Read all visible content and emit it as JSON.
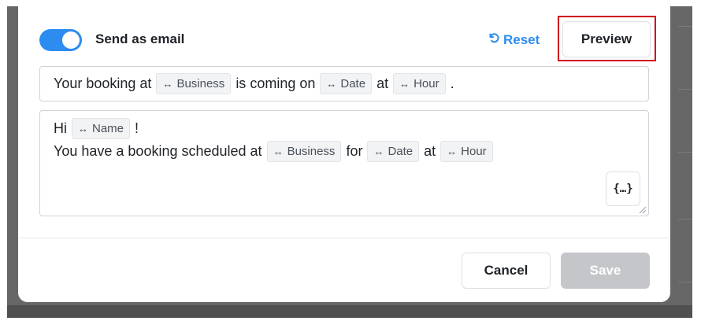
{
  "header": {
    "send_as_email_label": "Send as email",
    "send_as_email_on": true,
    "reset_label": "Reset",
    "preview_label": "Preview"
  },
  "subject": {
    "parts": [
      "Your booking at",
      "Business",
      "is coming on",
      "Date",
      "at",
      "Hour",
      "."
    ]
  },
  "body": {
    "line1": [
      "Hi",
      "Name",
      "!"
    ],
    "line2": [
      "You have a booking scheduled at",
      "Business",
      "for",
      "Date",
      "at",
      "Hour"
    ]
  },
  "chip_arrow": "↔",
  "variables_button_label": "{…}",
  "footer": {
    "cancel_label": "Cancel",
    "save_label": "Save"
  },
  "colors": {
    "accent": "#2d8cf0",
    "highlight": "#d0021b",
    "disabled": "#c4c6c9"
  }
}
